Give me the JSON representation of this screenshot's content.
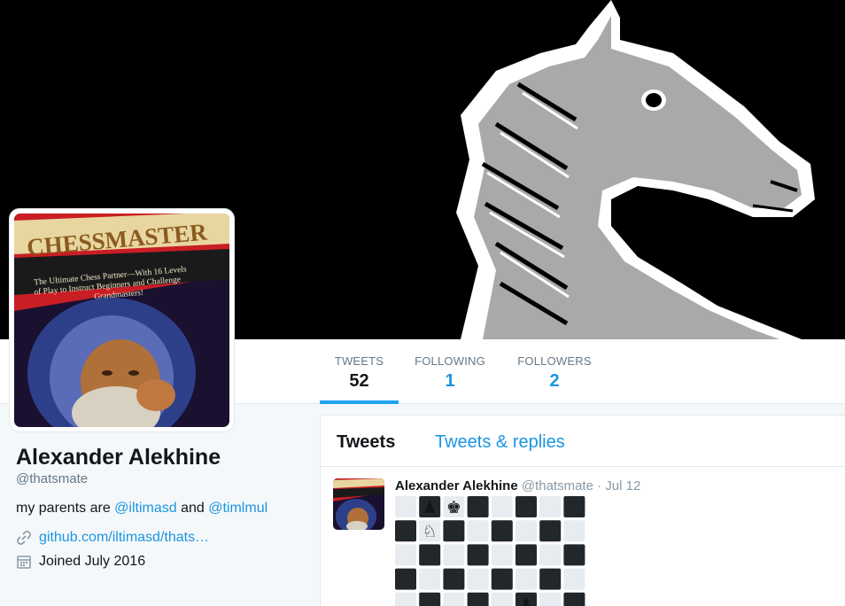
{
  "banner": {
    "icon": "chess-knight-icon",
    "colors": {
      "bg": "#000000",
      "knight_fill": "#a9a9a9",
      "knight_highlight": "#ffffff"
    }
  },
  "avatar": {
    "title": "CHESSMASTER",
    "tagline": [
      "The Ultimate Chess Partner—With 16 Levels",
      "of Play to Instruct Beginners and Challenge",
      "Grandmasters!"
    ]
  },
  "nav": {
    "tweets": {
      "label": "TWEETS",
      "count": "52"
    },
    "following": {
      "label": "FOLLOWING",
      "count": "1"
    },
    "followers": {
      "label": "FOLLOWERS",
      "count": "2"
    }
  },
  "profile": {
    "name": "Alexander Alekhine",
    "handle": "@thatsmate",
    "bio_prefix": "my parents are ",
    "bio_mention1": "@iltimasd",
    "bio_and": " and ",
    "bio_mention2": "@timlmul",
    "link": "github.com/iltimasd/thats…",
    "joined": "Joined July 2016"
  },
  "timeline": {
    "tabs": {
      "tweets": "Tweets",
      "replies": "Tweets & replies"
    },
    "tweet": {
      "name": "Alexander Alekhine",
      "handle": "@thatsmate",
      "dot": "·",
      "time": "Jul 12",
      "board": [
        [
          "",
          "♟",
          "♚",
          "",
          "",
          "",
          "",
          ""
        ],
        [
          "",
          "♘",
          "",
          "",
          "",
          "",
          "",
          ""
        ],
        [
          "",
          "",
          "",
          "",
          "",
          "",
          "",
          ""
        ],
        [
          "",
          "",
          "",
          "",
          "",
          "",
          "",
          ""
        ],
        [
          "",
          "",
          "",
          "",
          "",
          "♟",
          "",
          ""
        ]
      ]
    }
  },
  "colors": {
    "link": "#1b95e0",
    "accent": "#1da1f2",
    "muted": "#657786",
    "dark_square": "#22272b",
    "light_square": "#e6ecf0"
  }
}
